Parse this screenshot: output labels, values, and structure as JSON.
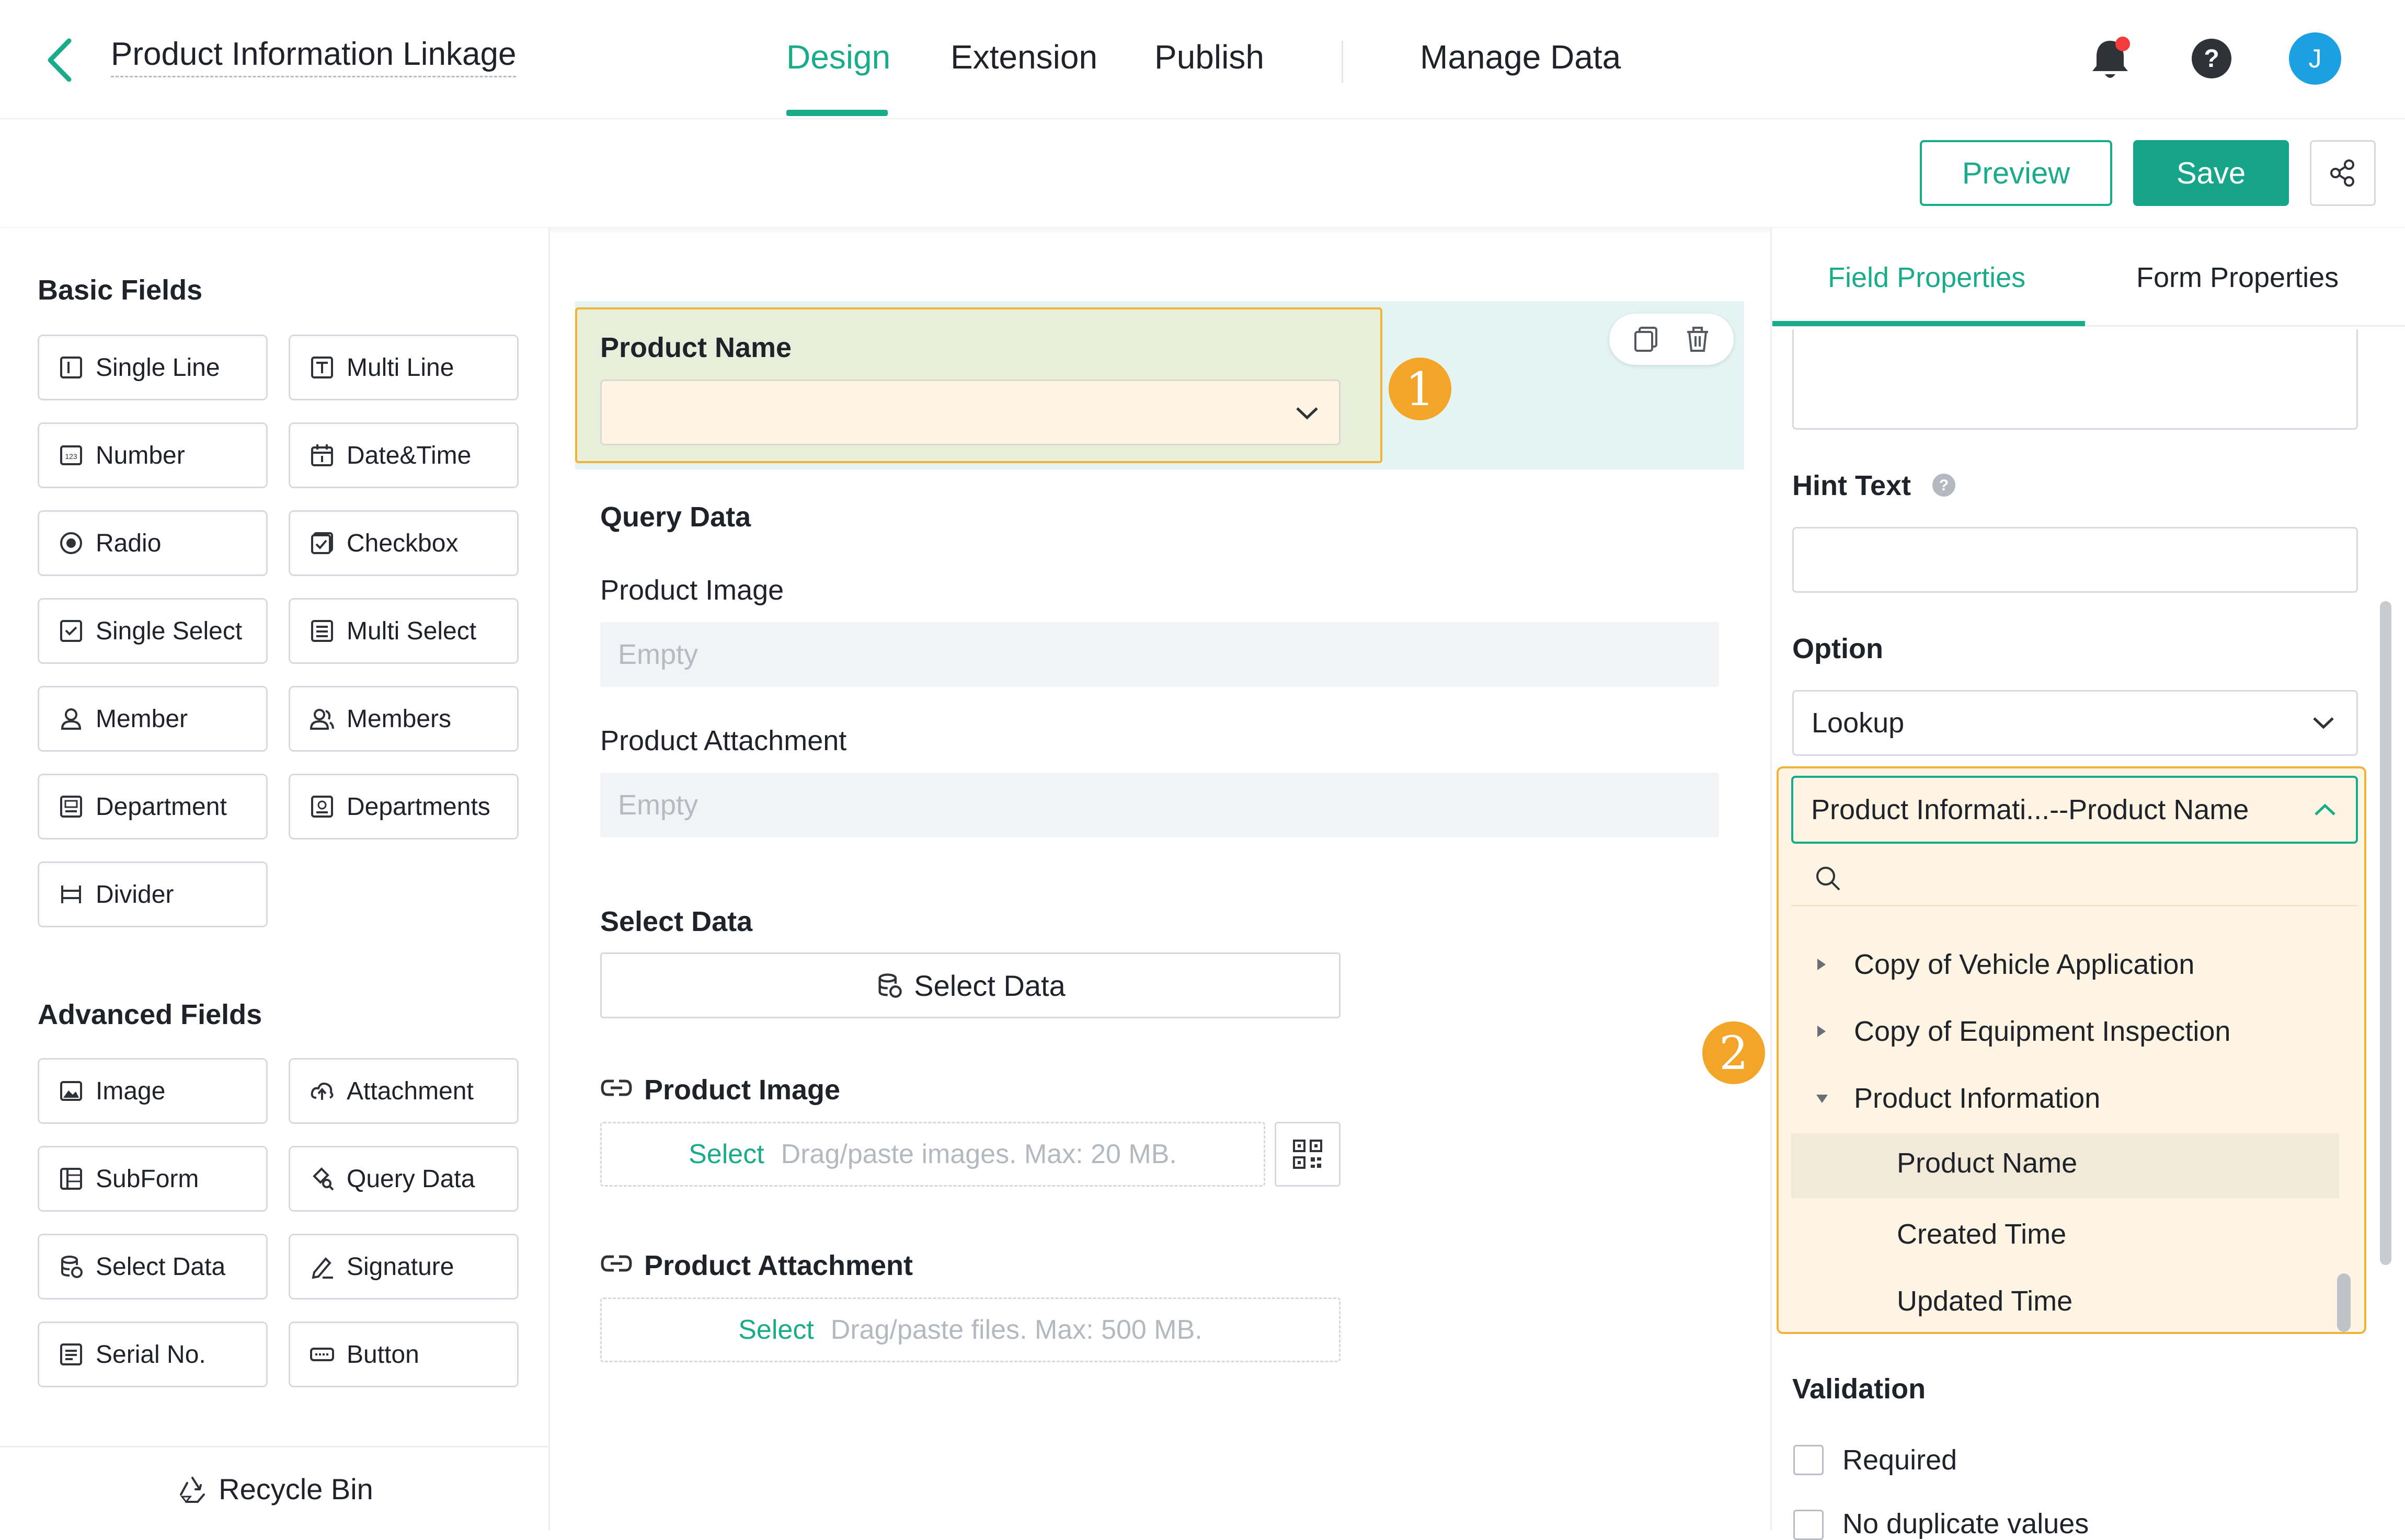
{
  "header": {
    "title": "Product Information Linkage",
    "tabs": [
      {
        "label": "Design",
        "active": true
      },
      {
        "label": "Extension",
        "active": false
      },
      {
        "label": "Publish",
        "active": false
      },
      {
        "label": "Manage Data",
        "active": false
      }
    ],
    "avatar_initial": "J"
  },
  "toolbar": {
    "preview_label": "Preview",
    "save_label": "Save"
  },
  "left_panel": {
    "basic_title": "Basic Fields",
    "basic_fields": [
      "Single Line",
      "Multi Line",
      "Number",
      "Date&Time",
      "Radio",
      "Checkbox",
      "Single Select",
      "Multi Select",
      "Member",
      "Members",
      "Department",
      "Departments",
      "Divider"
    ],
    "advanced_title": "Advanced Fields",
    "advanced_fields": [
      "Image",
      "Attachment",
      "SubForm",
      "Query Data",
      "Select Data",
      "Signature",
      "Serial No.",
      "Button"
    ],
    "recycle_label": "Recycle Bin"
  },
  "canvas": {
    "selected_field_label": "Product Name",
    "badge1": "1",
    "query_section": "Query Data",
    "query_fields": [
      {
        "label": "Product Image",
        "value": "Empty"
      },
      {
        "label": "Product Attachment",
        "value": "Empty"
      }
    ],
    "select_section": "Select Data",
    "select_button": "Select Data",
    "image_field": {
      "label": "Product Image",
      "select": "Select",
      "hint": "Drag/paste images. Max: 20 MB."
    },
    "attach_field": {
      "label": "Product Attachment",
      "select": "Select",
      "hint": "Drag/paste files. Max: 500 MB."
    },
    "badge2": "2"
  },
  "right_panel": {
    "tabs": [
      {
        "label": "Field Properties",
        "active": true
      },
      {
        "label": "Form Properties",
        "active": false
      }
    ],
    "hint_text_label": "Hint Text",
    "option_label": "Option",
    "option_value": "Lookup",
    "lookup_value": "Product Informati...--Product Name",
    "tree": [
      {
        "label": "Copy of Vehicle Application",
        "level": 0,
        "expanded": false
      },
      {
        "label": "Copy of Equipment Inspection",
        "level": 0,
        "expanded": false
      },
      {
        "label": "Product Information",
        "level": 0,
        "expanded": true
      },
      {
        "label": "Product Name",
        "level": 1,
        "selected": true
      },
      {
        "label": "Created Time",
        "level": 1
      },
      {
        "label": "Updated Time",
        "level": 1
      }
    ],
    "validation_label": "Validation",
    "required_label": "Required",
    "no_duplicate_label": "No duplicate values"
  },
  "colors": {
    "accent": "#1aab8a",
    "highlight_border": "#f0b43c",
    "badge": "#f3a529",
    "selected_band": "#e4f4f2"
  }
}
